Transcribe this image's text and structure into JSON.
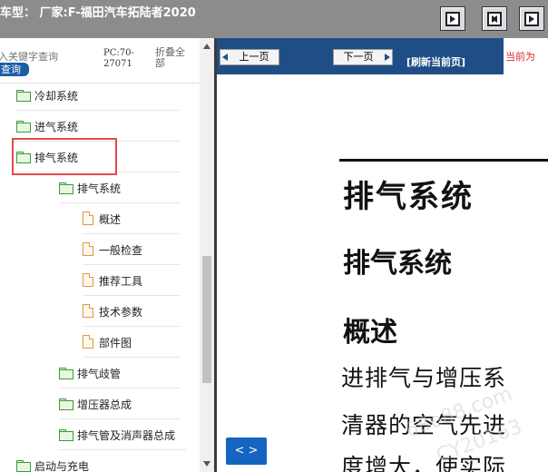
{
  "titlebar": {
    "title": "车型：  厂家:F-福田汽车拓陆者2020",
    "buttons": [
      "next-page-icon",
      "expand-icon",
      "play-icon"
    ]
  },
  "left": {
    "search_placeholder": "入关键字查询",
    "query_button": "查询",
    "pc_label": "PC:70-27071",
    "collapse_all": "折叠全部",
    "tree": [
      {
        "label": "冷却系统",
        "type": "folder",
        "level": 0
      },
      {
        "label": "进气系统",
        "type": "folder",
        "level": 0
      },
      {
        "label": "排气系统",
        "type": "folder",
        "level": 0,
        "selected": true
      },
      {
        "label": "排气系统",
        "type": "folder",
        "level": 1
      },
      {
        "label": "概述",
        "type": "doc",
        "level": 2
      },
      {
        "label": "一般检查",
        "type": "doc",
        "level": 2
      },
      {
        "label": "推荐工具",
        "type": "doc",
        "level": 2
      },
      {
        "label": "技术参数",
        "type": "doc",
        "level": 2
      },
      {
        "label": "部件图",
        "type": "doc",
        "level": 2
      },
      {
        "label": "排气歧管",
        "type": "folder",
        "level": 1
      },
      {
        "label": "增压器总成",
        "type": "folder",
        "level": 1
      },
      {
        "label": "排气管及消声器总成",
        "type": "folder",
        "level": 1
      },
      {
        "label": "启动与充电",
        "type": "folder",
        "level": 0
      }
    ]
  },
  "right": {
    "prev_label": "上一页",
    "next_label": "下一页",
    "refresh_label": "[刷新当前页]",
    "current_label": "当前为",
    "heading1": "排气系统",
    "heading2": "排气系统",
    "heading3": "概述",
    "para_line1": "进排气与增压系",
    "para_line2": "清器的空气先进",
    "para_line3": "度增大，使实际",
    "watermark1": "68e88.com",
    "watermark2": "CY20163",
    "toggle_label": "< >"
  }
}
